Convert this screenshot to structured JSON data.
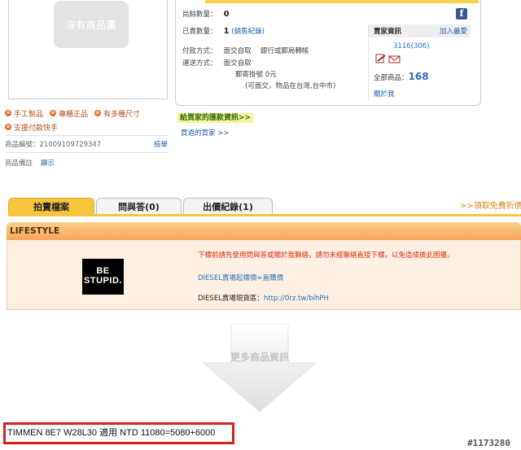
{
  "product_image": {
    "placeholder_text": "沒有商品圖"
  },
  "features": [
    "手工製品",
    "專櫃正品",
    "有多種尺寸",
    "支援付款快手"
  ],
  "product_info": {
    "code_label": "商品編號：21009109729347",
    "report_label": "檢舉",
    "note_label": "商品備註",
    "note_link": "顯示"
  },
  "details": {
    "remaining_label": "尚餘數量：",
    "remaining_value": "0",
    "sold_label": "已賣數量：",
    "sold_value": "1",
    "sold_link": "(銷售紀錄)",
    "payment_label": "付款方式：",
    "payment_value": "面交自取　 銀行或郵局轉帳",
    "shipping_label": "運送方式：",
    "shipping_value": "面交自取",
    "shipping_post": "郵寄掛號  0元",
    "shipping_note": "(可面交，物品在台灣,台中市)"
  },
  "seller": {
    "title": "賣家資訊",
    "follow_link": "加入最愛",
    "id": "3116(306)",
    "total_label": "全部商品：",
    "total_value": "168",
    "about_link": "關於我"
  },
  "links": {
    "buyer_reviews": "給買家的匯款資訊>>",
    "buyers_bought": "買過的買家 >>"
  },
  "tabs": [
    {
      "label": "拍賣檔案",
      "active": true
    },
    {
      "label": "問與答(0)",
      "active": false
    },
    {
      "label": "出價紀錄(1)",
      "active": false
    }
  ],
  "free_link": ">>領取免費折價",
  "lifestyle": {
    "title": "LIFESTYLE",
    "logo_line1": "BE",
    "logo_line2": "STUPID.",
    "red_text": "下標前請先使用問與答或關於我聯絡，請勿未經聯絡直接下標，以免造成彼此困擾。",
    "blue_text": "DIESEL賣場起標價=直購價",
    "store_label": "DIESEL賣場現貨區：",
    "store_url": "http://0rz.tw/bihPH"
  },
  "more_info": "更多商品資訊",
  "caption": "TIMMEN 8E7 W28L30 適用 NTD 11080=5080+6000",
  "watermark": "#1173280",
  "colors": {
    "accent": "#f7c53d",
    "link": "#1f5fa8",
    "caption_border": "#d6201f"
  }
}
